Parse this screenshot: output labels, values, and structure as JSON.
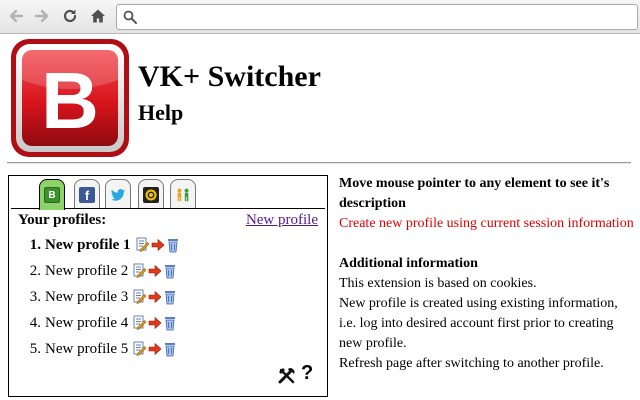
{
  "browser": {
    "address_value": "",
    "address_placeholder": ""
  },
  "header": {
    "logo_letter": "B",
    "title": "VK+ Switcher",
    "subtitle": "Help"
  },
  "tabs": [
    {
      "name": "tab-vkplus",
      "icon": "vkplus-icon",
      "active": true,
      "color": "#8ed36a"
    },
    {
      "name": "tab-facebook",
      "icon": "facebook-icon",
      "active": false,
      "color": "#3b5998"
    },
    {
      "name": "tab-twitter",
      "icon": "twitter-icon",
      "active": false,
      "color": "#2aa9e0"
    },
    {
      "name": "tab-odnoklassniki",
      "icon": "circle-badge-icon",
      "active": false,
      "color": "#e8a317"
    },
    {
      "name": "tab-people",
      "icon": "people-icon",
      "active": false,
      "color": "#f0a020"
    }
  ],
  "profiles": {
    "label": "Your profiles:",
    "new_profile_link": "New profile",
    "items": [
      {
        "num": "1.",
        "name": "New profile 1",
        "current": true
      },
      {
        "num": "2.",
        "name": "New profile 2",
        "current": false
      },
      {
        "num": "3.",
        "name": "New profile 3",
        "current": false
      },
      {
        "num": "4.",
        "name": "New profile 4",
        "current": false
      },
      {
        "num": "5.",
        "name": "New profile 5",
        "current": false
      }
    ]
  },
  "footer": {
    "help_glyph": "?"
  },
  "info": {
    "hint": "Move mouse pointer to any element to see it's description",
    "description": "Create new profile using current session information",
    "additional_title": "Additional information",
    "lines": [
      "This extension is based on cookies.",
      "New profile is created using existing information, i.e. log into desired account first prior to creating new profile.",
      "Refresh page after switching to another profile."
    ]
  },
  "colors": {
    "logo_red": "#d8141c",
    "active_tab": "#8ed36a",
    "description_red": "#e00000",
    "visited_link": "#551a8b"
  }
}
